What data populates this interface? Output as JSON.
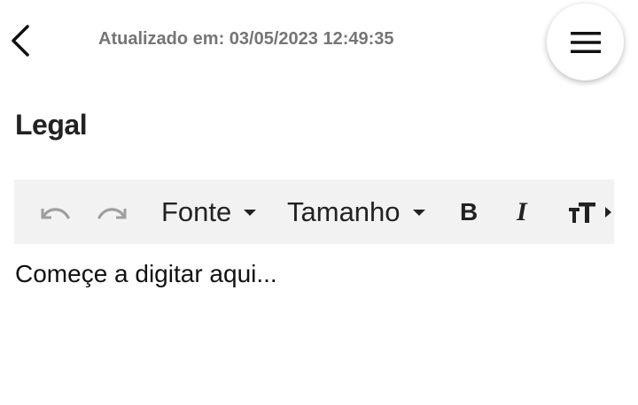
{
  "header": {
    "back_icon": "chevron-left-icon",
    "updated_label": "Atualizado em: 03/05/2023 12:49:35",
    "menu_icon": "hamburger-menu-icon"
  },
  "section": {
    "title": "Legal"
  },
  "toolbar": {
    "undo_icon": "undo-icon",
    "redo_icon": "redo-icon",
    "font_label": "Fonte",
    "size_label": "Tamanho",
    "bold_label": "B",
    "italic_label": "I",
    "text_size_icon": "text-size-icon",
    "scroll_icon": "caret-right-icon"
  },
  "editor": {
    "placeholder": "Começe a digitar aqui..."
  },
  "colors": {
    "muted_text": "#757575",
    "toolbar_bg": "#f2f2f2",
    "disabled_icon": "#9e9e9e"
  }
}
